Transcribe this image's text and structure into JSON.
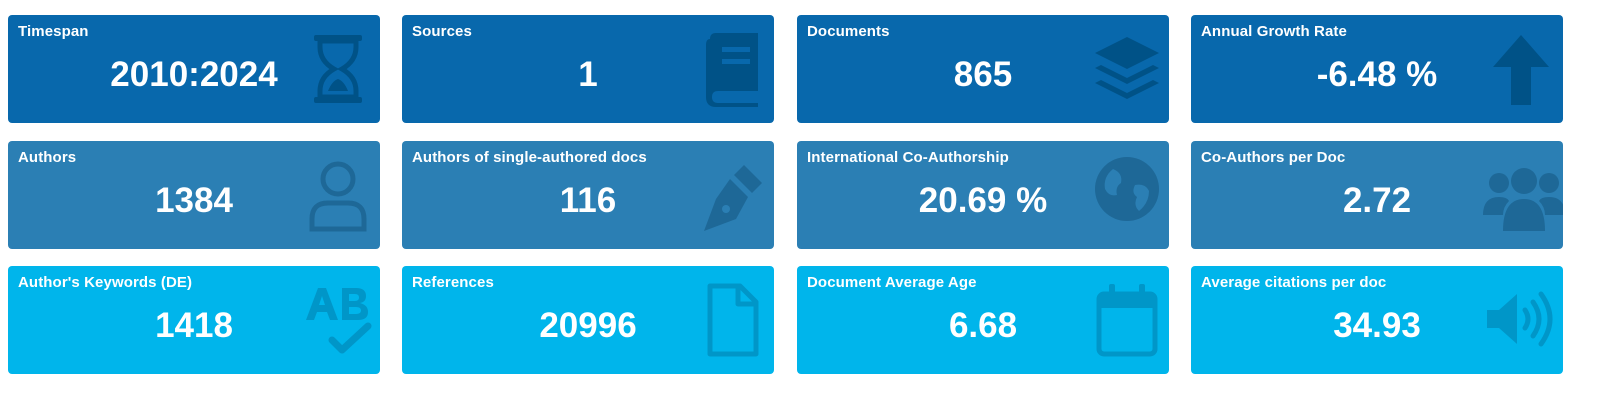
{
  "cards": [
    {
      "title": "Timespan",
      "value": "2010:2024",
      "icon": "hourglass-icon"
    },
    {
      "title": "Sources",
      "value": "1",
      "icon": "book-icon"
    },
    {
      "title": "Documents",
      "value": "865",
      "icon": "layers-icon"
    },
    {
      "title": "Annual Growth Rate",
      "value": "-6.48 %",
      "icon": "arrow-up-icon"
    },
    {
      "title": "Authors",
      "value": "1384",
      "icon": "user-icon"
    },
    {
      "title": "Authors of single-authored docs",
      "value": "116",
      "icon": "pen-nib-icon"
    },
    {
      "title": "International Co-Authorship",
      "value": "20.69 %",
      "icon": "globe-icon"
    },
    {
      "title": "Co-Authors per Doc",
      "value": "2.72",
      "icon": "users-icon"
    },
    {
      "title": "Author's Keywords (DE)",
      "value": "1418",
      "icon": "spell-check-icon"
    },
    {
      "title": "References",
      "value": "20996",
      "icon": "file-icon"
    },
    {
      "title": "Document Average Age",
      "value": "6.68",
      "icon": "calendar-icon"
    },
    {
      "title": "Average citations per doc",
      "value": "34.93",
      "icon": "volume-icon"
    }
  ],
  "colors": {
    "row1": "#0868ac",
    "row2": "#2b7fb4",
    "row3": "#00b5eb"
  }
}
